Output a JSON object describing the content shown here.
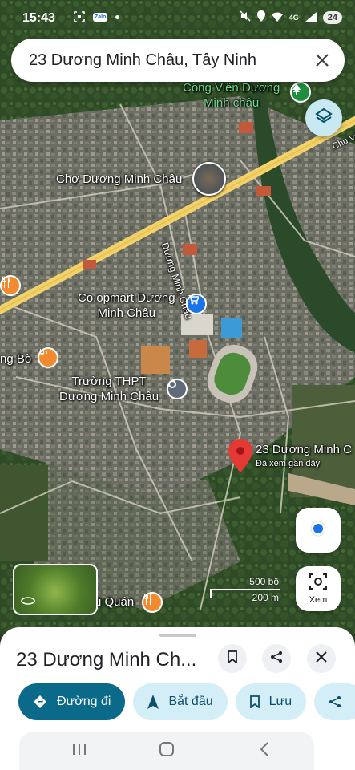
{
  "status_bar": {
    "time": "15:43",
    "zalo_label": "Zalo",
    "network": "4G",
    "battery": "24"
  },
  "search": {
    "query": "23 Dương Minh Châu, Tây Ninh",
    "close_icon": "close-icon"
  },
  "map": {
    "labels": {
      "park": "Công Viên Dương\nMinh châu",
      "market": "Chợ Dương Minh Châu",
      "road": "Dương Minh Châu",
      "coopmart": "Co.opmart Dương\nMinh Châu",
      "restaurant_left": "ng Bò",
      "school": "Trường THPT\nDương Minh Châu",
      "pin_title": "23 Dương Minh C",
      "pin_subtitle": "Đã xem gần đây",
      "quan": "u Quán",
      "edge_road": "Chu Va"
    },
    "scale": {
      "imperial": "500 bộ",
      "metric": "200 m"
    },
    "xem_label": "Xem",
    "colors": {
      "pin": "#e53935",
      "location_dot": "#1a73e8",
      "road": "#f2d36b"
    }
  },
  "sheet": {
    "title": "23 Dương Minh Ch...",
    "actions": [
      {
        "label": "Đường đi",
        "icon": "directions-icon"
      },
      {
        "label": "Bắt đầu",
        "icon": "navigation-arrow-icon"
      },
      {
        "label": "Lưu",
        "icon": "bookmark-icon"
      }
    ]
  }
}
